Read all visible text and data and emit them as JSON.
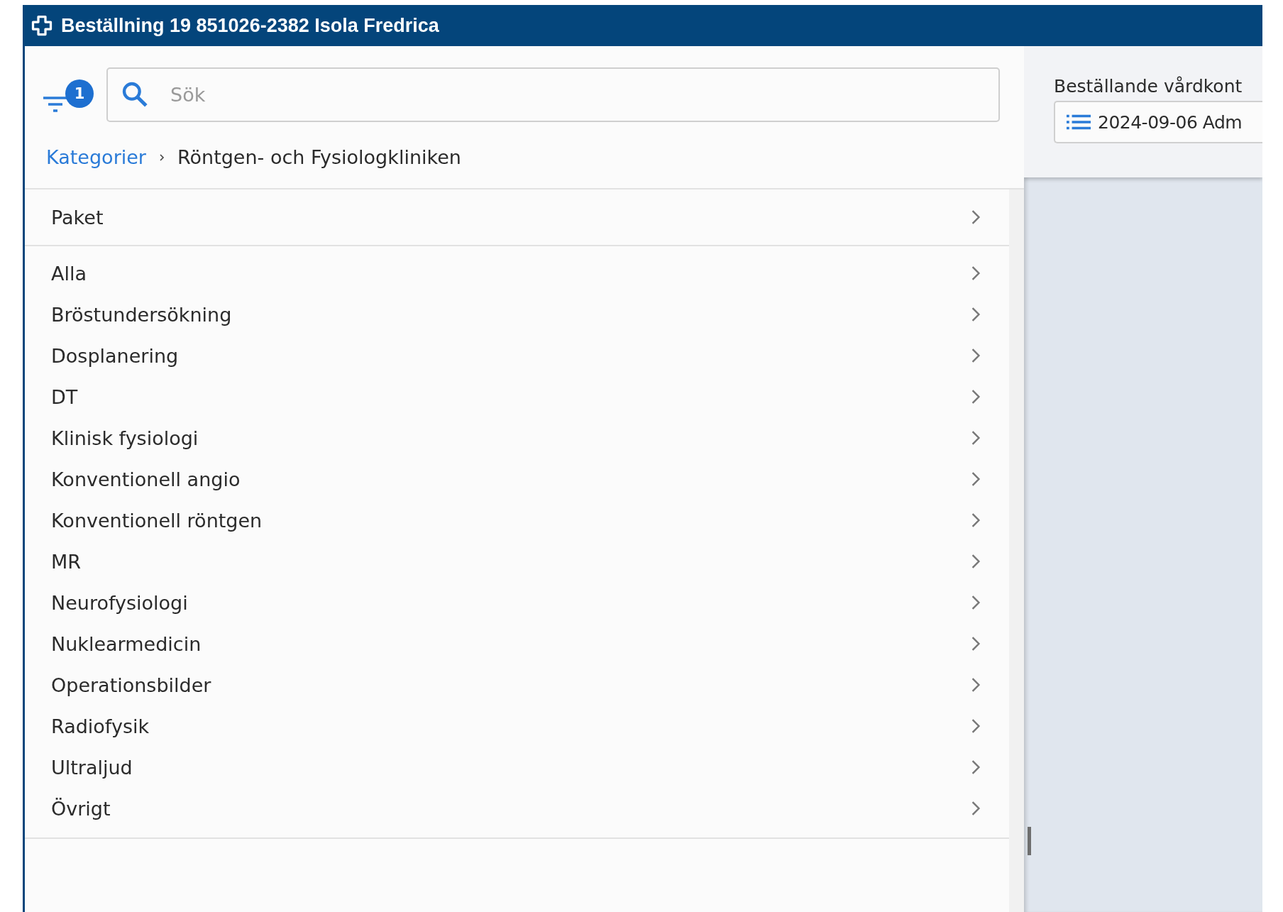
{
  "window": {
    "title": "Beställning 19 851026-2382 Isola Fredrica"
  },
  "filter": {
    "badge": "1"
  },
  "search": {
    "placeholder": "Sök"
  },
  "breadcrumb": [
    {
      "label": "Kategorier",
      "kind": "link"
    },
    {
      "label": "Röntgen- och Fysiologkliniken",
      "kind": "current"
    }
  ],
  "package_item": {
    "label": "Paket"
  },
  "categories": [
    {
      "label": "Alla"
    },
    {
      "label": "Bröstundersökning"
    },
    {
      "label": "Dosplanering"
    },
    {
      "label": "DT"
    },
    {
      "label": "Klinisk fysiologi"
    },
    {
      "label": "Konventionell angio"
    },
    {
      "label": "Konventionell röntgen"
    },
    {
      "label": "MR"
    },
    {
      "label": "Neurofysiologi"
    },
    {
      "label": "Nuklearmedicin"
    },
    {
      "label": "Operationsbilder"
    },
    {
      "label": "Radiofysik"
    },
    {
      "label": "Ultraljud"
    },
    {
      "label": "Övrigt"
    }
  ],
  "ordering_unit": {
    "label": "Beställande vårdkont",
    "value": "2024-09-06 Adm"
  }
}
